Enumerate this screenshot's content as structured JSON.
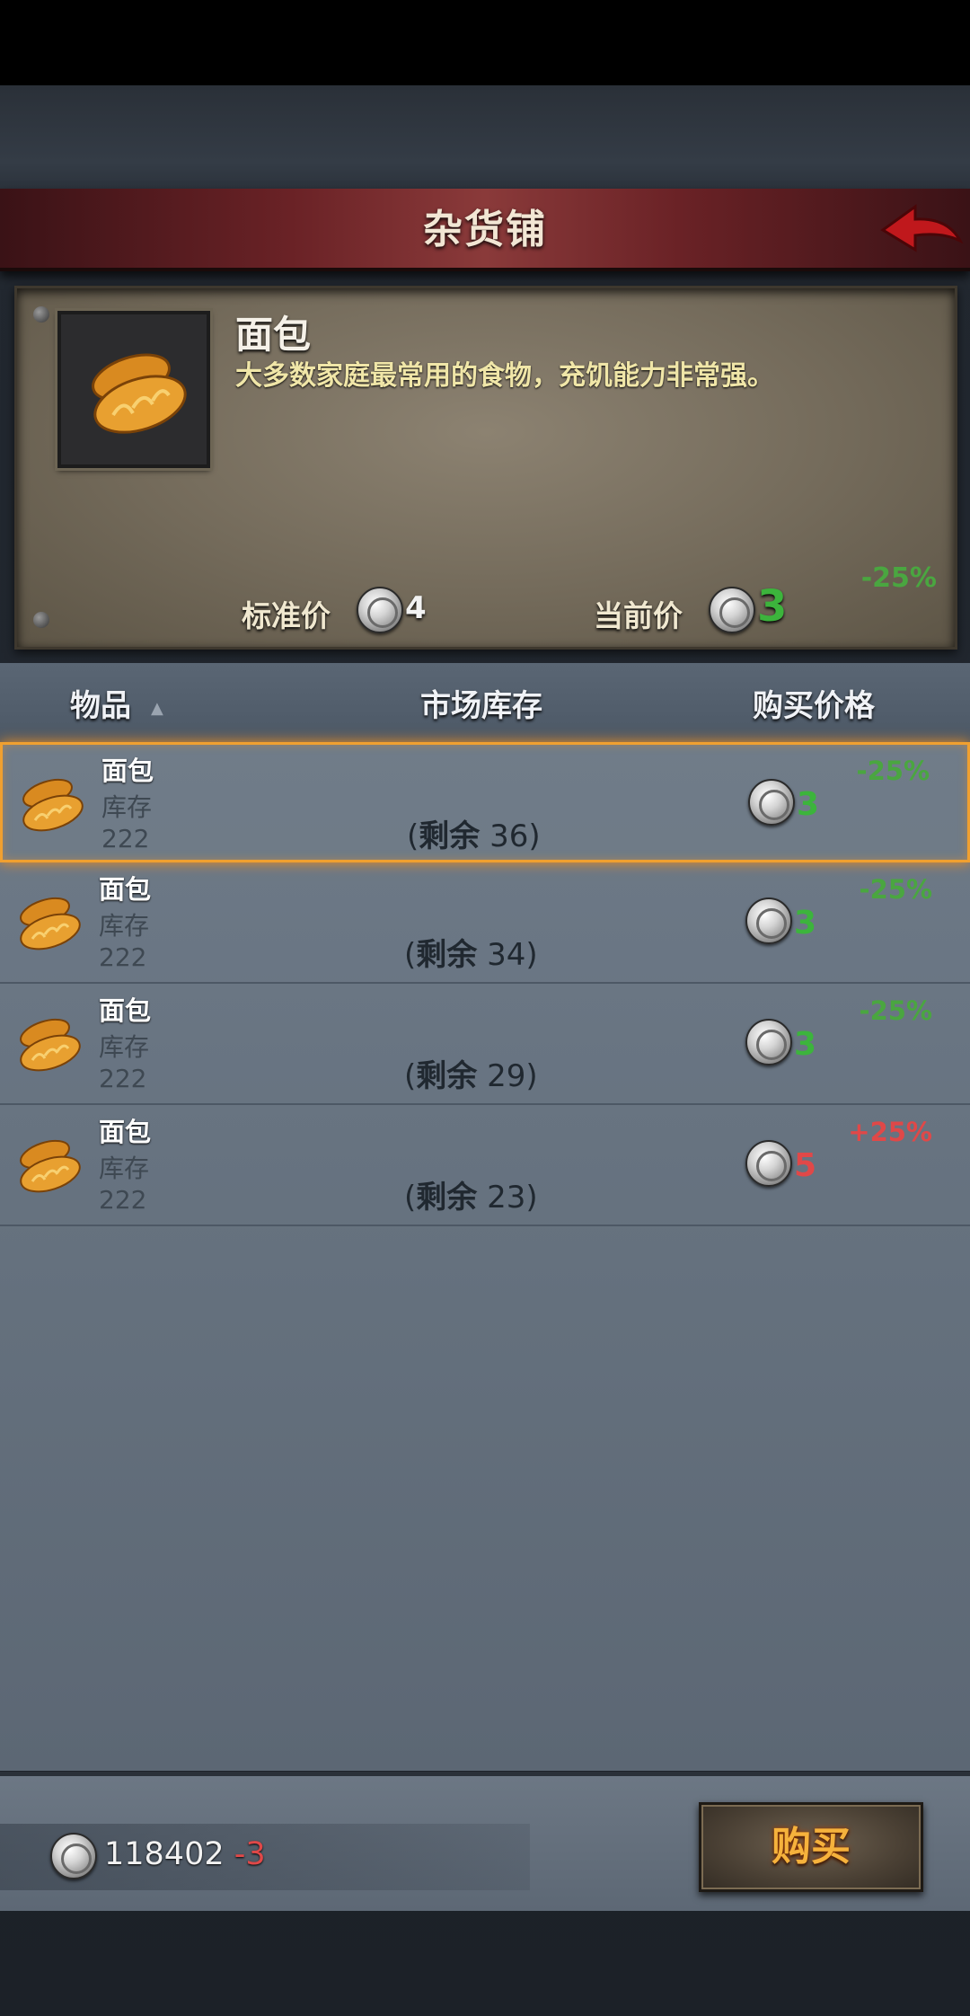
{
  "header": {
    "title": "杂货铺"
  },
  "detail": {
    "name": "面包",
    "description": "大多数家庭最常用的食物，充饥能力非常强。",
    "discount": "-25%",
    "standard_price_label": "标准价",
    "standard_price": "4",
    "current_price_label": "当前价",
    "current_price": "3"
  },
  "columns": {
    "item": "物品",
    "stock": "市场库存",
    "price": "购买价格"
  },
  "items": [
    {
      "name": "面包",
      "stock_label": "库存",
      "stock": "222",
      "remain_label": "剩余",
      "remain": "36",
      "price": "3",
      "discount": "-25%"
    },
    {
      "name": "面包",
      "stock_label": "库存",
      "stock": "222",
      "remain_label": "剩余",
      "remain": "34",
      "price": "3",
      "discount": "-25%"
    },
    {
      "name": "面包",
      "stock_label": "库存",
      "stock": "222",
      "remain_label": "剩余",
      "remain": "29",
      "price": "3",
      "discount": "-25%"
    },
    {
      "name": "面包",
      "stock_label": "库存",
      "stock": "222",
      "remain_label": "剩余",
      "remain": "23",
      "price": "5",
      "discount": "+25%"
    }
  ],
  "wallet": {
    "amount": "118402",
    "delta": "-3"
  },
  "buy_button": {
    "label": "购买"
  },
  "colors": {
    "discount_green": "#4aa640",
    "markup_red": "#e04848",
    "price_green": "#3cb43c",
    "accent_orange": "#f0a030"
  }
}
